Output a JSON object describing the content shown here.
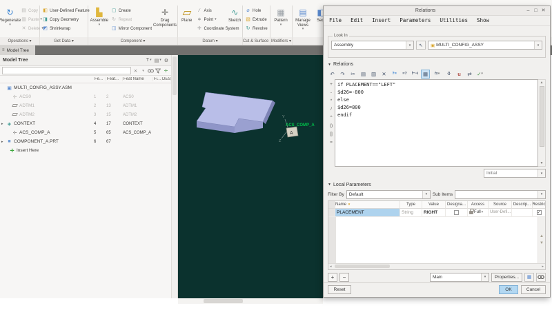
{
  "icons": {
    "window_minimize": "–",
    "window_maximize": "□",
    "window_close": "✕",
    "dropdown": "▾",
    "expander_right": "▸",
    "regenerate": "↻",
    "copy": "▤",
    "paste": "▥",
    "delete": "✕",
    "user_defined_feature": "◧",
    "copy_geometry": "◨",
    "shrinkwrap": "◩",
    "assemble": "▙",
    "create": "▢",
    "repeat": "↻",
    "mirror_component": "◫",
    "drag_components": "✛",
    "axis": "∕",
    "point": "∗",
    "coordinate_system": "✛",
    "sketch": "∿",
    "hole": "⌀",
    "extrude": "▧",
    "revolve": "↻",
    "pattern": "▦",
    "manage_views": "▤",
    "sect": "◧",
    "tree_tab": "≡",
    "tree_assembly": "▣",
    "tree_csys": "✛",
    "tree_context": "◈",
    "tree_part": "■",
    "insert_here": "✛",
    "tree_filters": "T",
    "tree_columns": "▤",
    "tree_settings": "⚙",
    "search_clear": "✕",
    "add": "✛",
    "undo": "↶",
    "redo": "↷",
    "cut": "✂",
    "tb_copy": "▤",
    "tb_paste": "▥",
    "tb_delete": "✕",
    "insert_relation": "?=",
    "evaluate": "=?",
    "range": "⊢⊣",
    "sort_relations": "▦",
    "function_fx": "fx",
    "local_params_braces": "{}",
    "units": "u",
    "switch_dims": "⇄",
    "verify": "✓",
    "scroll_up": "▲",
    "scroll_down": "▼",
    "scroll_left": "◂",
    "scroll_right": "▸",
    "row_up": "▲",
    "row_down": "▼",
    "plus": "+",
    "minus": "−",
    "table_view": "▦",
    "cursor_select": "↖",
    "name_filter": "▼"
  },
  "ribbon": {
    "groups": [
      "Operations",
      "Get Data",
      "Component",
      "Datum",
      "Cut & Surface",
      "Modifiers"
    ],
    "buttons": {
      "regenerate": "Regenerate",
      "copy": "Copy",
      "paste": "Paste",
      "delete": "Delete",
      "user_defined_feature": "User-Defined Feature",
      "copy_geometry": "Copy Geometry",
      "shrinkwrap": "Shrinkwrap",
      "assemble": "Assemble",
      "create": "Create",
      "repeat": "Repeat",
      "mirror_component": "Mirror Component",
      "drag_components": "Drag Components",
      "plane": "Plane",
      "axis": "Axis",
      "point": "Point",
      "coordinate_system": "Coordinate System",
      "sketch": "Sketch",
      "hole": "Hole",
      "extrude": "Extrude",
      "revolve": "Revolve",
      "pattern": "Pattern",
      "manage_views": "Manage Views",
      "sect": "Sect"
    }
  },
  "model_tree": {
    "tab_label": "Model Tree",
    "panel_title": "Model Tree",
    "columns": [
      "Fe...",
      "Feat...",
      "Feat Name",
      "Fi...",
      "DES"
    ],
    "items": [
      {
        "expander": "",
        "name": "MULTI_CONFIG_ASSY.ASM",
        "fe": "",
        "feat": "",
        "feat_name": ""
      },
      {
        "expander": "",
        "name": "ACS0",
        "fe": "1",
        "feat": "2",
        "feat_name": "ACS0"
      },
      {
        "expander": "",
        "name": "ADTM1",
        "fe": "2",
        "feat": "13",
        "feat_name": "ADTM1"
      },
      {
        "expander": "",
        "name": "ADTM2",
        "fe": "3",
        "feat": "15",
        "feat_name": "ADTM2"
      },
      {
        "expander": "▸",
        "name": "CONTEXT",
        "fe": "4",
        "feat": "17",
        "feat_name": "CONTEXT"
      },
      {
        "expander": "",
        "name": "ACS_COMP_A",
        "fe": "5",
        "feat": "65",
        "feat_name": "ACS_COMP_A"
      },
      {
        "expander": "▸",
        "name": "COMPONENT_A.PRT",
        "fe": "6",
        "feat": "67",
        "feat_name": ""
      },
      {
        "expander": "",
        "name": "Insert Here",
        "fe": "",
        "feat": "",
        "feat_name": ""
      }
    ]
  },
  "viewport": {
    "csys_label": "ACS_COMP_A",
    "axis_y": "Y",
    "axis_z": "Z",
    "tag_letter": "A",
    "colors": {
      "background": "#0b322e",
      "csys_label": "#00c04a",
      "part_top": "#b9bee8",
      "part_front": "#8f95c8"
    }
  },
  "dialog": {
    "title": "Relations",
    "menu": [
      "File",
      "Edit",
      "Insert",
      "Parameters",
      "Utilities",
      "Show"
    ],
    "look_in": {
      "label": "Look In",
      "scope": "Assembly",
      "model": "MULTI_CONFIG_ASSY"
    },
    "relations": {
      "header": "Relations",
      "operators": [
        "+",
        "-",
        "*",
        "/",
        "^",
        "()",
        "[]",
        "="
      ],
      "code_lines": [
        "if PLACEMENT==\"LEFT\"",
        " $d26=-800",
        "else",
        " $d26=800",
        "endif"
      ],
      "initial": "Initial"
    },
    "local_parameters": {
      "header": "Local Parameters",
      "filter_by_label": "Filter By",
      "filter_value": "Default",
      "sub_items_label": "Sub Items",
      "sub_items_value": "",
      "columns": [
        "Name",
        "Type",
        "Value",
        "Designa...",
        "Access",
        "Source",
        "Descrip...",
        "Restric"
      ],
      "rows": [
        {
          "name": "PLACEMENT",
          "type": "String",
          "value": "RIGHT",
          "designated_mark": "",
          "access": "Full",
          "source": "User-Defi...",
          "description": "",
          "restricted_mark": "✓"
        }
      ],
      "group_value": "Main",
      "properties_label": "Properties..."
    },
    "footer": {
      "reset": "Reset",
      "ok": "OK",
      "cancel": "Cancel"
    }
  }
}
